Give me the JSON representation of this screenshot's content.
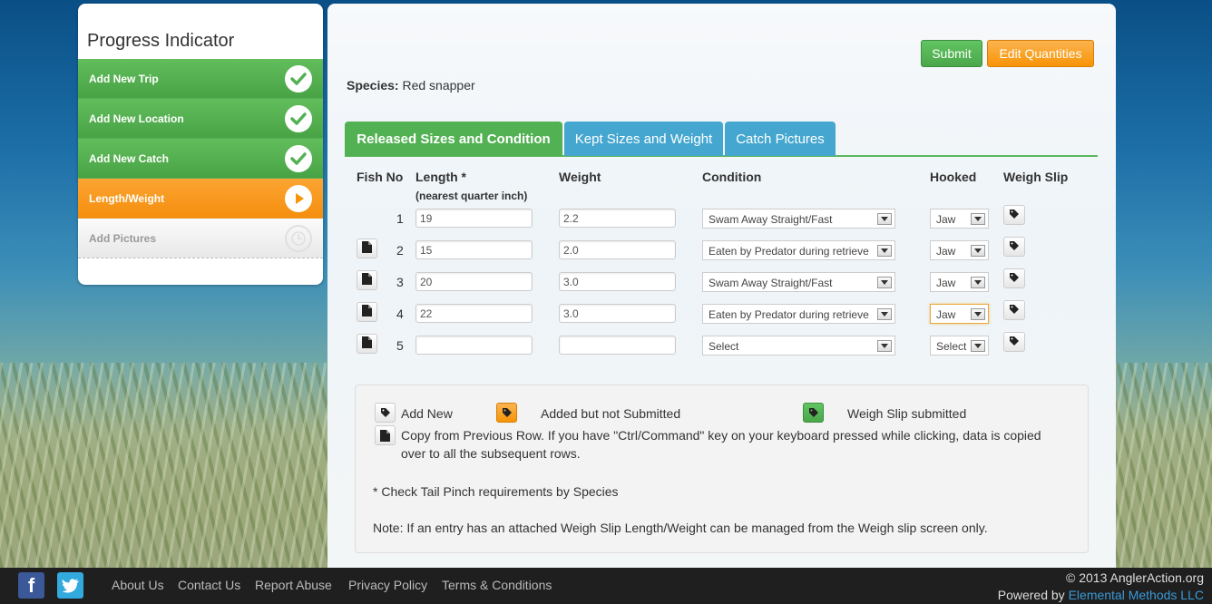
{
  "sidebar": {
    "title": "Progress Indicator",
    "steps": [
      {
        "label": "Add New Trip",
        "state": "done"
      },
      {
        "label": "Add New Location",
        "state": "done"
      },
      {
        "label": "Add New Catch",
        "state": "done"
      },
      {
        "label": "Length/Weight",
        "state": "current"
      },
      {
        "label": "Add Pictures",
        "state": "todo"
      }
    ]
  },
  "toolbar": {
    "submit_label": "Submit",
    "edit_label": "Edit Quantities"
  },
  "species": {
    "label": "Species:",
    "value": "Red snapper"
  },
  "tabs": [
    {
      "label": "Released Sizes and Condition",
      "active": true
    },
    {
      "label": "Kept Sizes and Weight",
      "active": false
    },
    {
      "label": "Catch Pictures",
      "active": false
    }
  ],
  "table": {
    "headers": {
      "fish_no": "Fish No",
      "length": "Length *",
      "length_sub": "(nearest quarter inch)",
      "weight": "Weight",
      "condition": "Condition",
      "hooked": "Hooked",
      "weigh_slip": "Weigh Slip"
    },
    "rows": [
      {
        "no": "1",
        "length": "19",
        "weight": "2.2",
        "condition": "Swam Away Straight/Fast",
        "hooked": "Jaw"
      },
      {
        "no": "2",
        "length": "15",
        "weight": "2.0",
        "condition": "Eaten by Predator during retrieve",
        "hooked": "Jaw"
      },
      {
        "no": "3",
        "length": "20",
        "weight": "3.0",
        "condition": "Swam Away Straight/Fast",
        "hooked": "Jaw"
      },
      {
        "no": "4",
        "length": "22",
        "weight": "3.0",
        "condition": "Eaten by Predator during retrieve",
        "hooked": "Jaw"
      },
      {
        "no": "5",
        "length": "",
        "weight": "",
        "condition": "Select",
        "hooked": "Select"
      }
    ]
  },
  "legend": {
    "add_new": "Add New",
    "added_not_submitted": "Added but not Submitted",
    "weigh_slip_submitted": "Weigh Slip submitted",
    "copy_line1": "Copy from Previous Row. If you have \"Ctrl/Command\" key on your keyboard pressed while clicking, data is copied",
    "copy_line2": "over to all the subsequent rows.",
    "tail_pinch": "* Check Tail Pinch requirements by Species",
    "note": "Note: If an entry has an attached Weigh Slip Length/Weight can be managed from the Weigh slip screen only."
  },
  "footer": {
    "links": [
      "About Us",
      "Contact Us",
      "Report Abuse",
      "Privacy Policy",
      "Terms & Conditions"
    ],
    "copyright": "© 2013 AnglerAction.org",
    "powered_by": "Powered by",
    "powered_link": "Elemental Methods LLC"
  },
  "colors": {
    "green": "#52b152",
    "orange": "#f89406",
    "blue": "#45a7cf"
  }
}
